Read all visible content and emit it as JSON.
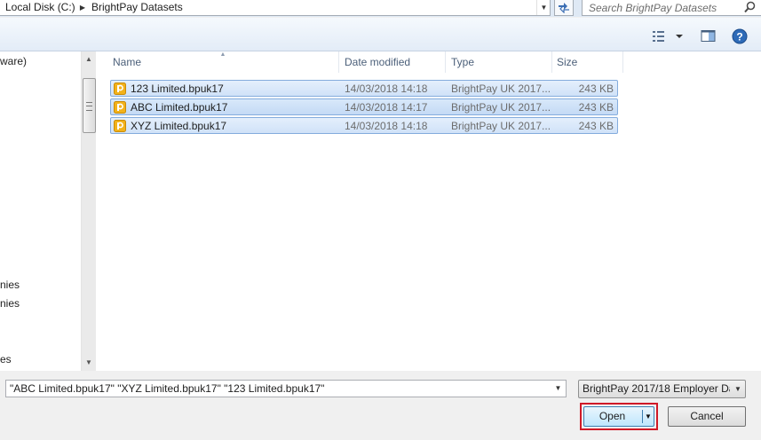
{
  "address_bar": {
    "crumbs": [
      "Local Disk (C:)",
      "BrightPay Datasets"
    ],
    "separator_icon": "chevron-right-icon",
    "dropdown_icon": "chevron-down-icon",
    "refresh_icon": "refresh-icon"
  },
  "search": {
    "placeholder": "Search BrightPay Datasets",
    "icon": "search-icon"
  },
  "toolbar": {
    "views_icon": "views-icon",
    "preview_icon": "preview-pane-icon",
    "help_icon": "help-icon"
  },
  "nav": {
    "partial_items": [
      "ware)",
      "nies",
      "nies",
      "es"
    ]
  },
  "file_list": {
    "columns": [
      "Name",
      "Date modified",
      "Type",
      "Size"
    ],
    "files": [
      {
        "name": "123 Limited.bpuk17",
        "date": "14/03/2018 14:18",
        "type": "BrightPay UK 2017...",
        "size": "243 KB"
      },
      {
        "name": "ABC Limited.bpuk17",
        "date": "14/03/2018 14:17",
        "type": "BrightPay UK 2017...",
        "size": "243 KB"
      },
      {
        "name": "XYZ Limited.bpuk17",
        "date": "14/03/2018 14:18",
        "type": "BrightPay UK 2017...",
        "size": "243 KB"
      }
    ],
    "file_icon": "brightpay-file-icon"
  },
  "footer": {
    "filename_value": "\"ABC Limited.bpuk17\" \"XYZ Limited.bpuk17\" \"123 Limited.bpuk17\"",
    "filetype_value": "BrightPay 2017/18 Employer Da",
    "open_label": "Open",
    "cancel_label": "Cancel"
  },
  "colors": {
    "selection_fill": "#d0e2f8",
    "selection_border": "#84acdd",
    "highlight_box": "#d01927"
  }
}
